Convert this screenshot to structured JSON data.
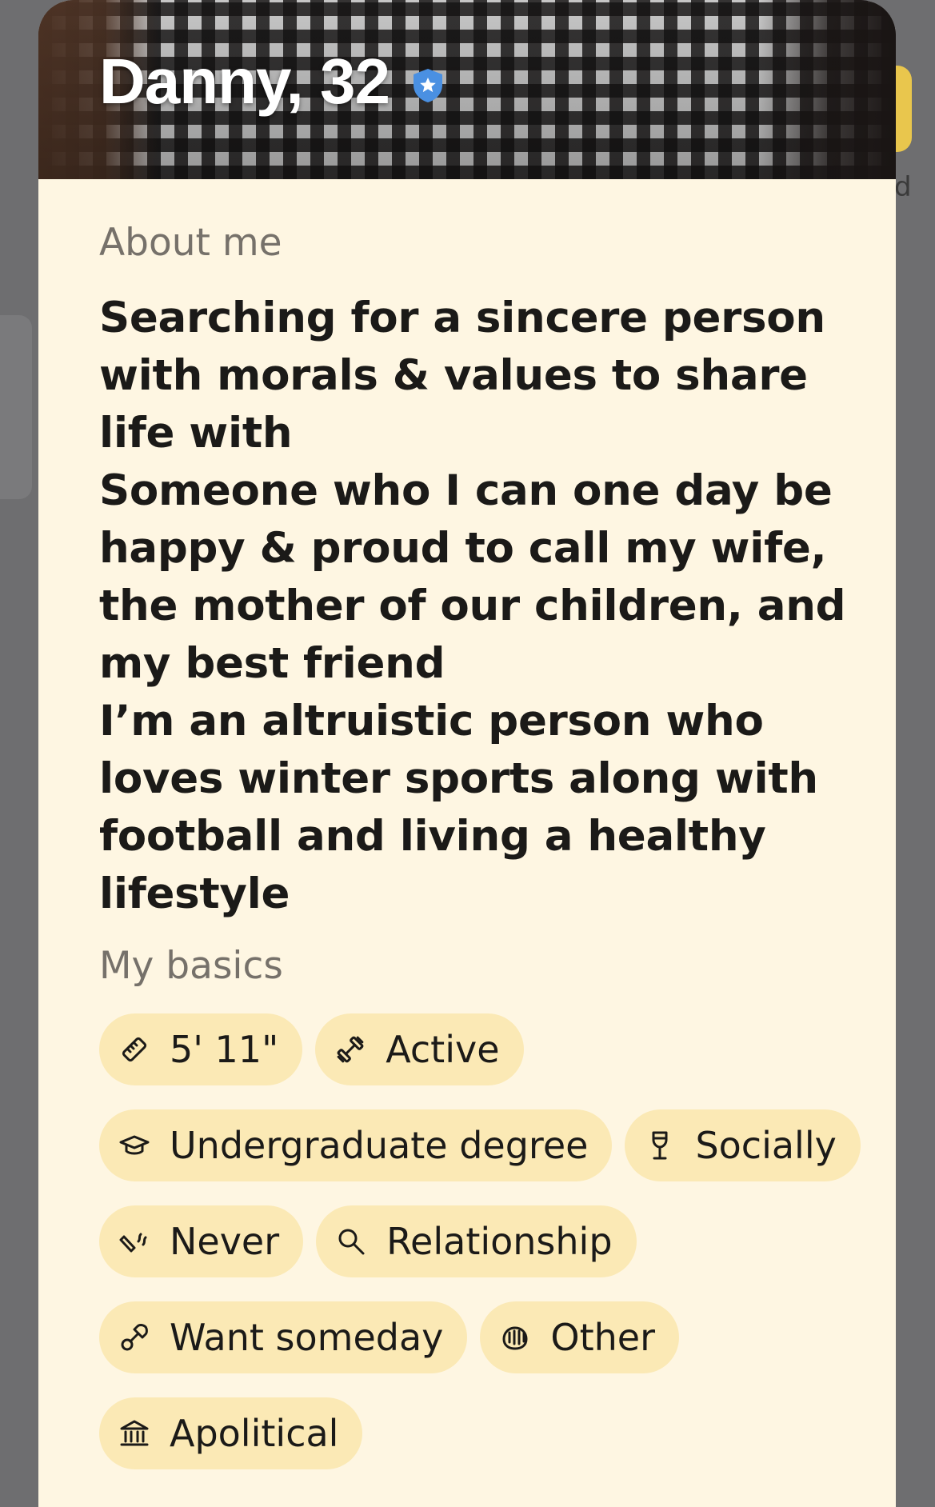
{
  "profile": {
    "name_age": "Danny, 32",
    "verified": true
  },
  "about": {
    "label": "About me",
    "bio_lines": [
      "Searching for a sincere person with morals & values to share life with",
      "Someone who I can one day be happy & proud to call my wife, the mother of our children, and my best friend",
      "I’m an altruistic person who loves winter sports along with football and living a healthy lifestyle"
    ]
  },
  "basics": {
    "label": "My basics",
    "chips": [
      {
        "icon": "ruler-icon",
        "text": "5' 11\""
      },
      {
        "icon": "dumbbell-icon",
        "text": "Active"
      },
      {
        "icon": "graduation-cap-icon",
        "text": "Undergraduate degree"
      },
      {
        "icon": "wine-glass-icon",
        "text": "Socially"
      },
      {
        "icon": "cigarette-icon",
        "text": "Never"
      },
      {
        "icon": "magnifier-icon",
        "text": "Relationship"
      },
      {
        "icon": "pacifier-icon",
        "text": "Want someday"
      },
      {
        "icon": "praying-hands-icon",
        "text": "Other"
      },
      {
        "icon": "bank-icon",
        "text": "Apolitical"
      }
    ]
  },
  "colors": {
    "card_background": "#fef6e2",
    "chip_background": "#fbe9b5",
    "verified_badge": "#4a90e2",
    "accent_yellow": "#e9c64d"
  }
}
